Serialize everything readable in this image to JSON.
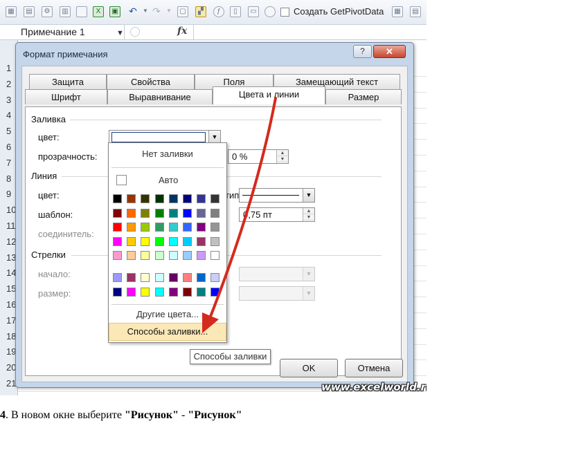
{
  "excel": {
    "qat_checkbox_label": "Создать GetPivotData",
    "name_box": "Примечание 1",
    "fx": "fx",
    "row_numbers": [
      "1",
      "2",
      "3",
      "4",
      "5",
      "6",
      "7",
      "8",
      "9",
      "10",
      "11",
      "12",
      "13",
      "14",
      "15",
      "16",
      "17",
      "18",
      "19",
      "20",
      "21"
    ]
  },
  "dialog": {
    "title": "Формат примечания",
    "help_glyph": "?",
    "close_glyph": "✕",
    "tabs_back": [
      "Защита",
      "Свойства",
      "Поля",
      "Замещающий текст"
    ],
    "tabs_front": [
      "Шрифт",
      "Выравнивание",
      "Цвета и линии",
      "Размер"
    ],
    "active_tab": "Цвета и линии",
    "fill": {
      "section": "Заливка",
      "color_label": "цвет:",
      "transparency_label": "прозрачность:",
      "transparency_value": "0 %"
    },
    "line": {
      "section": "Линия",
      "color_label": "цвет:",
      "pattern_label": "шаблон:",
      "connector_label": "соединитель:",
      "type_label": "тип:",
      "thickness_value": "0,75 пт"
    },
    "arrows": {
      "section": "Стрелки",
      "start_label": "начало:",
      "size_label": "размер:"
    },
    "ok_label": "OK",
    "cancel_label": "Отмена"
  },
  "color_dropdown": {
    "no_fill": "Нет заливки",
    "auto": "Авто",
    "more_colors": "Другие цвета...",
    "fill_effects": "Способы заливки...",
    "palette_main": [
      [
        "#000000",
        "#993300",
        "#333300",
        "#003300",
        "#003366",
        "#000080",
        "#333399",
        "#333333"
      ],
      [
        "#800000",
        "#FF6600",
        "#808000",
        "#008000",
        "#008080",
        "#0000FF",
        "#666699",
        "#808080"
      ],
      [
        "#FF0000",
        "#FF9900",
        "#99CC00",
        "#339966",
        "#33CCCC",
        "#3366FF",
        "#800080",
        "#969696"
      ],
      [
        "#FF00FF",
        "#FFCC00",
        "#FFFF00",
        "#00FF00",
        "#00FFFF",
        "#00CCFF",
        "#993366",
        "#C0C0C0"
      ],
      [
        "#FF99CC",
        "#FFCC99",
        "#FFFF99",
        "#CCFFCC",
        "#CCFFFF",
        "#99CCFF",
        "#CC99FF",
        "#FFFFFF"
      ]
    ],
    "palette_extra": [
      [
        "#9999FF",
        "#993366",
        "#FFFFCC",
        "#CCFFFF",
        "#660066",
        "#FF8080",
        "#0066CC",
        "#CCCCFF"
      ],
      [
        "#000080",
        "#FF00FF",
        "#FFFF00",
        "#00FFFF",
        "#800080",
        "#800000",
        "#008080",
        "#0000FF"
      ]
    ]
  },
  "tooltip": "Способы заливки",
  "watermark": "www.excelworld.ru",
  "caption": {
    "number": "4",
    "text": ". В новом окне выберите ",
    "bold1": "\"Рисунок\"",
    "dash": " - ",
    "bold2": "\"Рисунок\""
  },
  "colors": {
    "arrow": "#d42a1e",
    "dialog_frame": "#c6d6ea",
    "hover_highlight": "#fbe8b7"
  }
}
